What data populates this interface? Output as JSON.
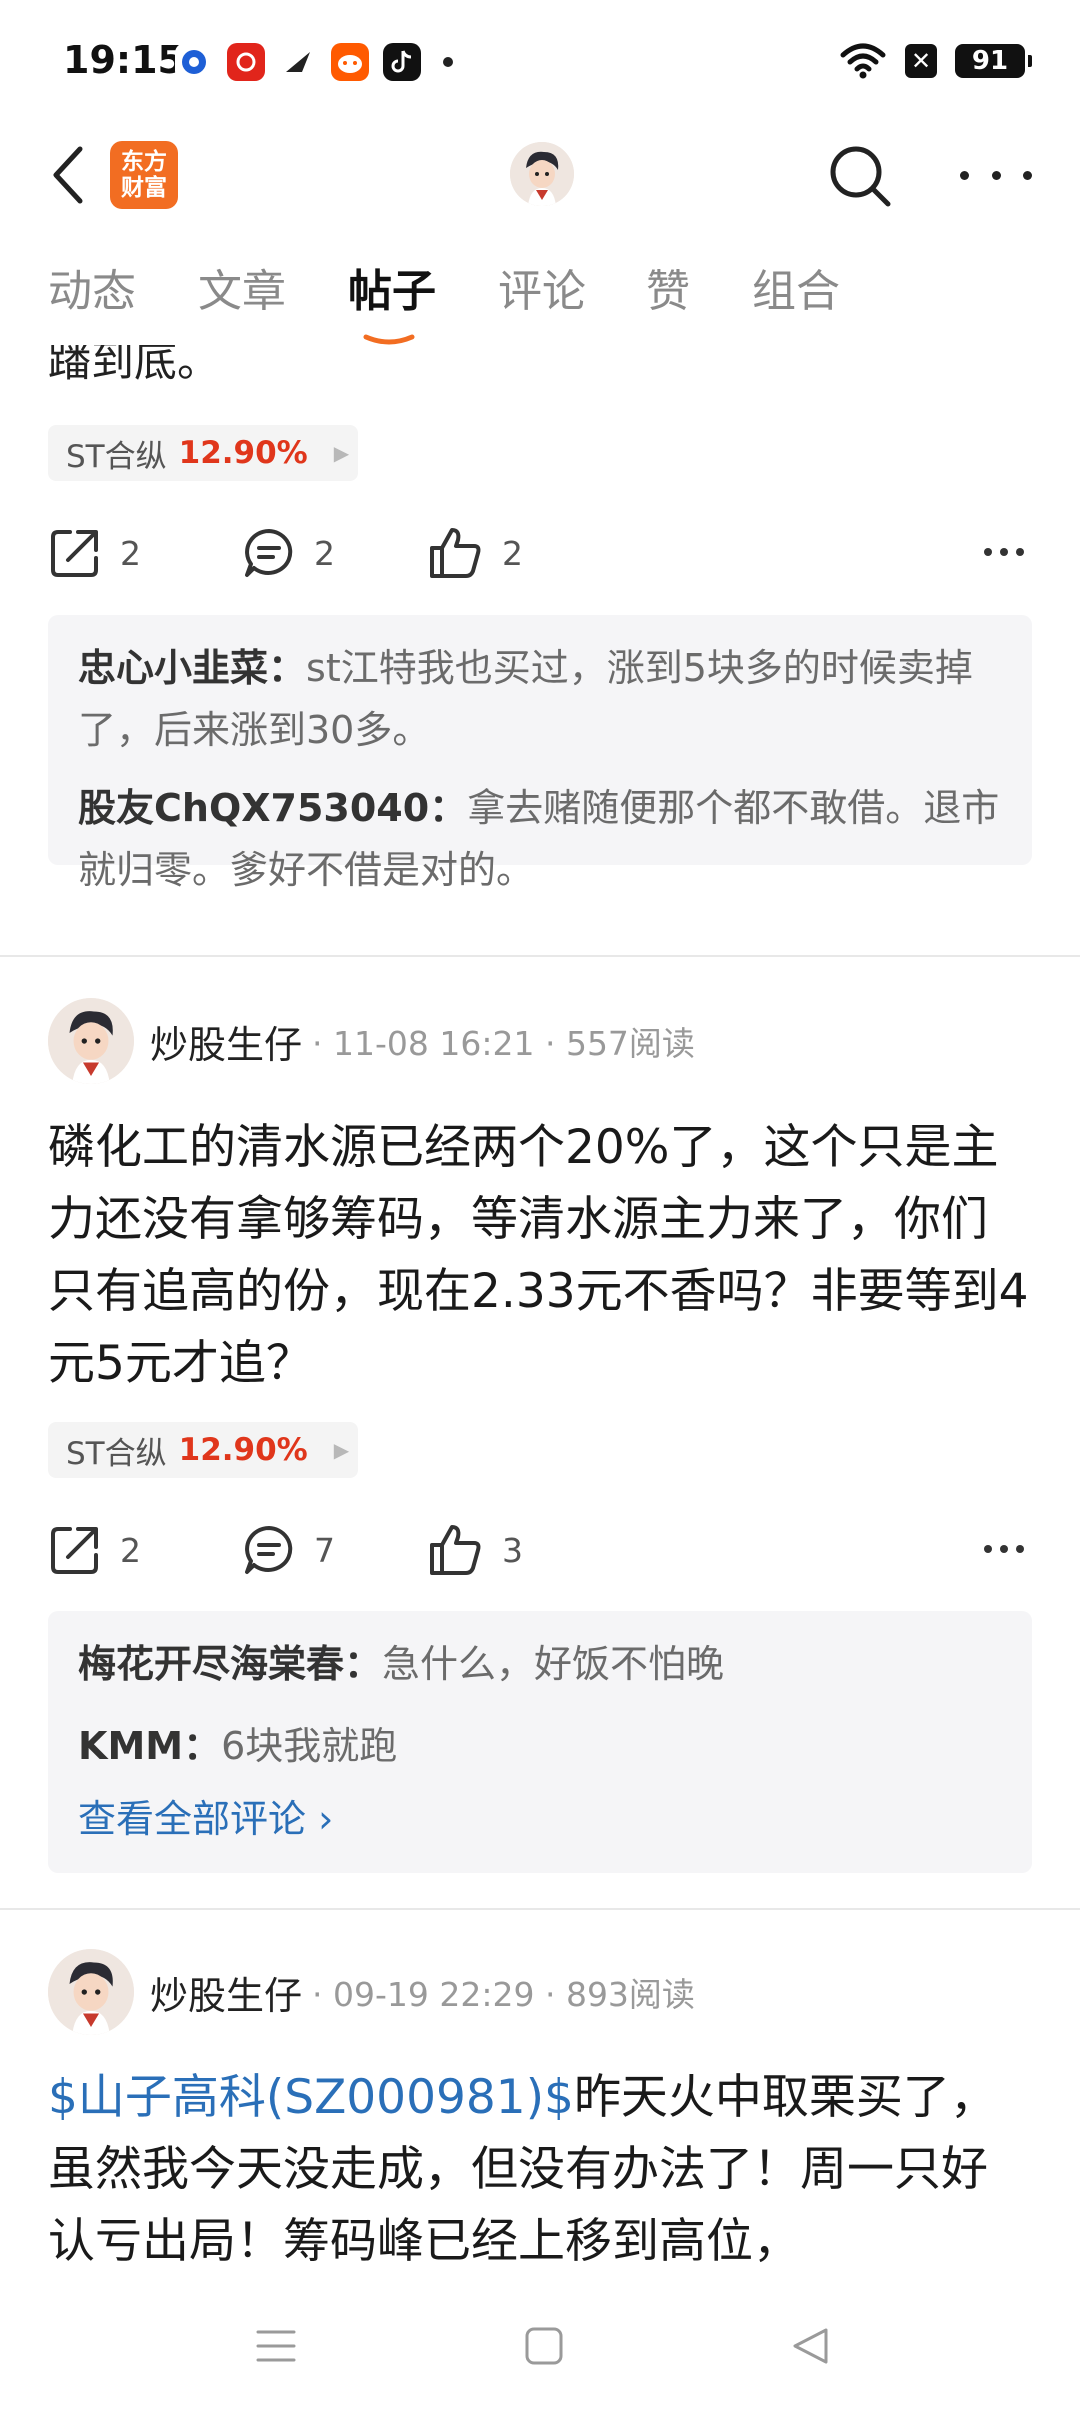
{
  "status_bar": {
    "time": "19:15",
    "battery": "91",
    "apps": [
      "blue-circle-app",
      "netease-music-app",
      "feather-app",
      "taobao-app",
      "tiktok-app"
    ]
  },
  "header": {
    "brand_line1": "东方",
    "brand_line2": "财富",
    "brand_color": "#f26d22"
  },
  "tabs": [
    {
      "label": "动态"
    },
    {
      "label": "文章"
    },
    {
      "label": "帖子",
      "active": true
    },
    {
      "label": "评论"
    },
    {
      "label": "赞"
    },
    {
      "label": "组合"
    }
  ],
  "feed": {
    "clipped_text": "蹯到底。",
    "post1": {
      "stock_name": "ST合纵",
      "stock_pct": "12.90%",
      "shares": "2",
      "comments": "2",
      "likes": "2",
      "comment_list": [
        {
          "author": "忠心小韭菜：",
          "text": "st江特我也买过，涨到5块多的时候卖掉了，后来涨到30多。"
        },
        {
          "author": "股友ChQX753040：",
          "text": "拿去赌随便那个都不敢借。退市就归零。爹好不借是对的。"
        }
      ]
    },
    "post2": {
      "author": "炒股生仔",
      "meta": "· 11-08 16:21 · 557阅读",
      "body": "磷化工的清水源已经两个20%了，这个只是主力还没有拿够筹码，等清水源主力来了，你们只有追高的份，现在2.33元不香吗？非要等到4元5元才追？",
      "stock_name": "ST合纵",
      "stock_pct": "12.90%",
      "shares": "2",
      "comments": "7",
      "likes": "3",
      "comment_list": [
        {
          "author": "梅花开尽海棠春：",
          "text": "急什么，好饭不怕晚"
        },
        {
          "author": "KMM：",
          "text": "6块我就跑"
        }
      ],
      "view_all": "查看全部评论 ›"
    },
    "post3": {
      "author": "炒股生仔",
      "meta": "· 09-19 22:29 · 893阅读",
      "stock_link": "$山子高科(SZ000981)$",
      "body": "昨天火中取栗买了，虽然我今天没走成，但没有办法了！周一只好认亏出局！筹码峰已经上移到高位，"
    }
  },
  "colors": {
    "accent_orange": "#f26d22",
    "rise_red": "#e0361b",
    "link_blue": "#2a6fb8"
  }
}
